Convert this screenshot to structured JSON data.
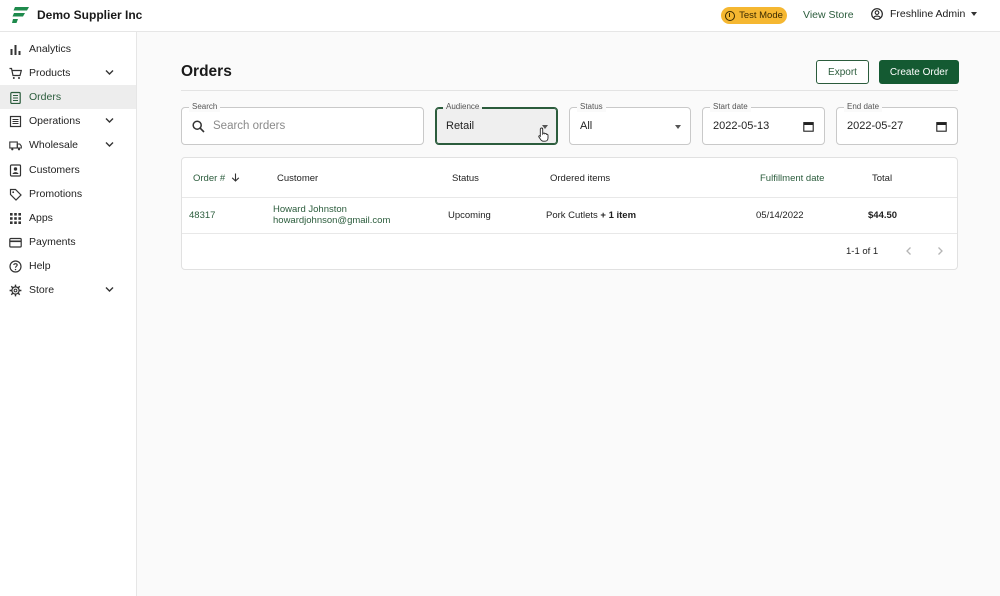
{
  "topbar": {
    "brand": "Demo Supplier Inc",
    "test_mode": "Test Mode",
    "view_store": "View Store",
    "admin": "Freshline Admin"
  },
  "sidebar": {
    "items": [
      {
        "label": "Analytics",
        "icon": "bar-chart-icon"
      },
      {
        "label": "Products",
        "icon": "cart-icon",
        "expandable": true
      },
      {
        "label": "Orders",
        "icon": "clipboard-icon",
        "active": true
      },
      {
        "label": "Operations",
        "icon": "list-icon",
        "expandable": true
      },
      {
        "label": "Wholesale",
        "icon": "truck-icon",
        "expandable": true
      },
      {
        "label": "Customers",
        "icon": "contact-icon"
      },
      {
        "label": "Promotions",
        "icon": "tag-icon"
      },
      {
        "label": "Apps",
        "icon": "grid-icon"
      },
      {
        "label": "Payments",
        "icon": "card-icon"
      },
      {
        "label": "Help",
        "icon": "help-icon"
      },
      {
        "label": "Store",
        "icon": "gear-icon",
        "expandable": true
      }
    ]
  },
  "main": {
    "title": "Orders",
    "export_label": "Export",
    "create_label": "Create Order"
  },
  "filters": {
    "search": {
      "label": "Search",
      "placeholder": "Search orders"
    },
    "audience": {
      "label": "Audience",
      "value": "Retail"
    },
    "status": {
      "label": "Status",
      "value": "All"
    },
    "start_date": {
      "label": "Start date",
      "value": "2022-05-13"
    },
    "end_date": {
      "label": "End date",
      "value": "2022-05-27"
    }
  },
  "table": {
    "columns": [
      "Order #",
      "Customer",
      "Status",
      "Ordered items",
      "Fulfillment date",
      "Total"
    ],
    "rows": [
      {
        "order": "48317",
        "customer_name": "Howard Johnston",
        "customer_email": "howardjohnson@gmail.com",
        "status": "Upcoming",
        "items": "Pork Cutlets",
        "items_extra": "+ 1 item",
        "fulfillment": "05/14/2022",
        "total": "$44.50"
      }
    ],
    "pagination": "1-1 of 1"
  },
  "colors": {
    "accent": "#2b5c3c",
    "primary_button": "#145a32",
    "test_mode_badge": "#f5b731"
  }
}
